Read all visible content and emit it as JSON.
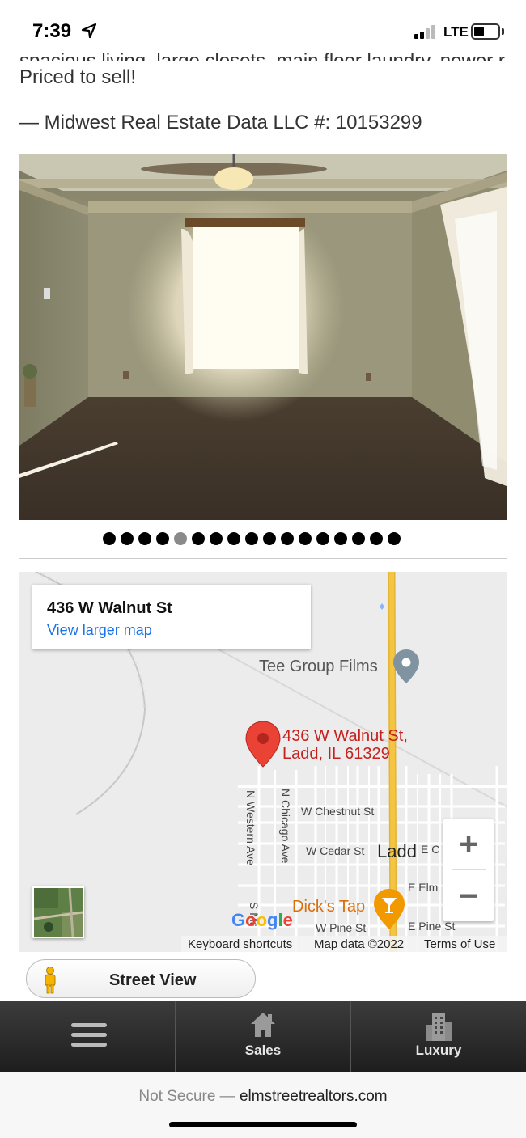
{
  "status_bar": {
    "time": "7:39",
    "network": "LTE"
  },
  "description": {
    "partial_line": "spacious living, large closets, main floor laundry, newer roof, garage",
    "text": "Priced to sell!",
    "mls_line": "— Midwest Real Estate Data LLC #: 10153299"
  },
  "gallery": {
    "total_images": 17,
    "current_index": 5
  },
  "map": {
    "card_title": "436 W Walnut St",
    "card_link": "View larger map",
    "pin_label_line1": "436 W Walnut St,",
    "pin_label_line2": "Ladd, IL 61329",
    "poi_tee": "Tee Group Films",
    "poi_dicks": "Dick's Tap",
    "town": "Ladd",
    "streets": {
      "chestnut": "W Chestnut St",
      "cedar": "W Cedar St",
      "elm": "E Elm",
      "e_c": "E C",
      "pine_w": "W Pine St",
      "pine_e": "E Pine St",
      "western": "N Western Ave",
      "chicago": "N Chicago Ave",
      "s_main": "S Mas"
    },
    "zoom_in": "+",
    "zoom_out": "−",
    "google_logo": "Google",
    "attribution": {
      "shortcuts": "Keyboard shortcuts",
      "map_data": "Map data ©2022",
      "terms": "Terms of Use"
    },
    "colors": {
      "highway": "#f5c542",
      "pin": "#ea4335"
    }
  },
  "street_view": {
    "label": "Street View"
  },
  "bottom_nav": {
    "menu_icon": "hamburger-icon",
    "sales_label": "Sales",
    "luxury_label": "Luxury"
  },
  "browser": {
    "not_secure": "Not Secure —",
    "domain": "elmstreetrealtors.com"
  }
}
